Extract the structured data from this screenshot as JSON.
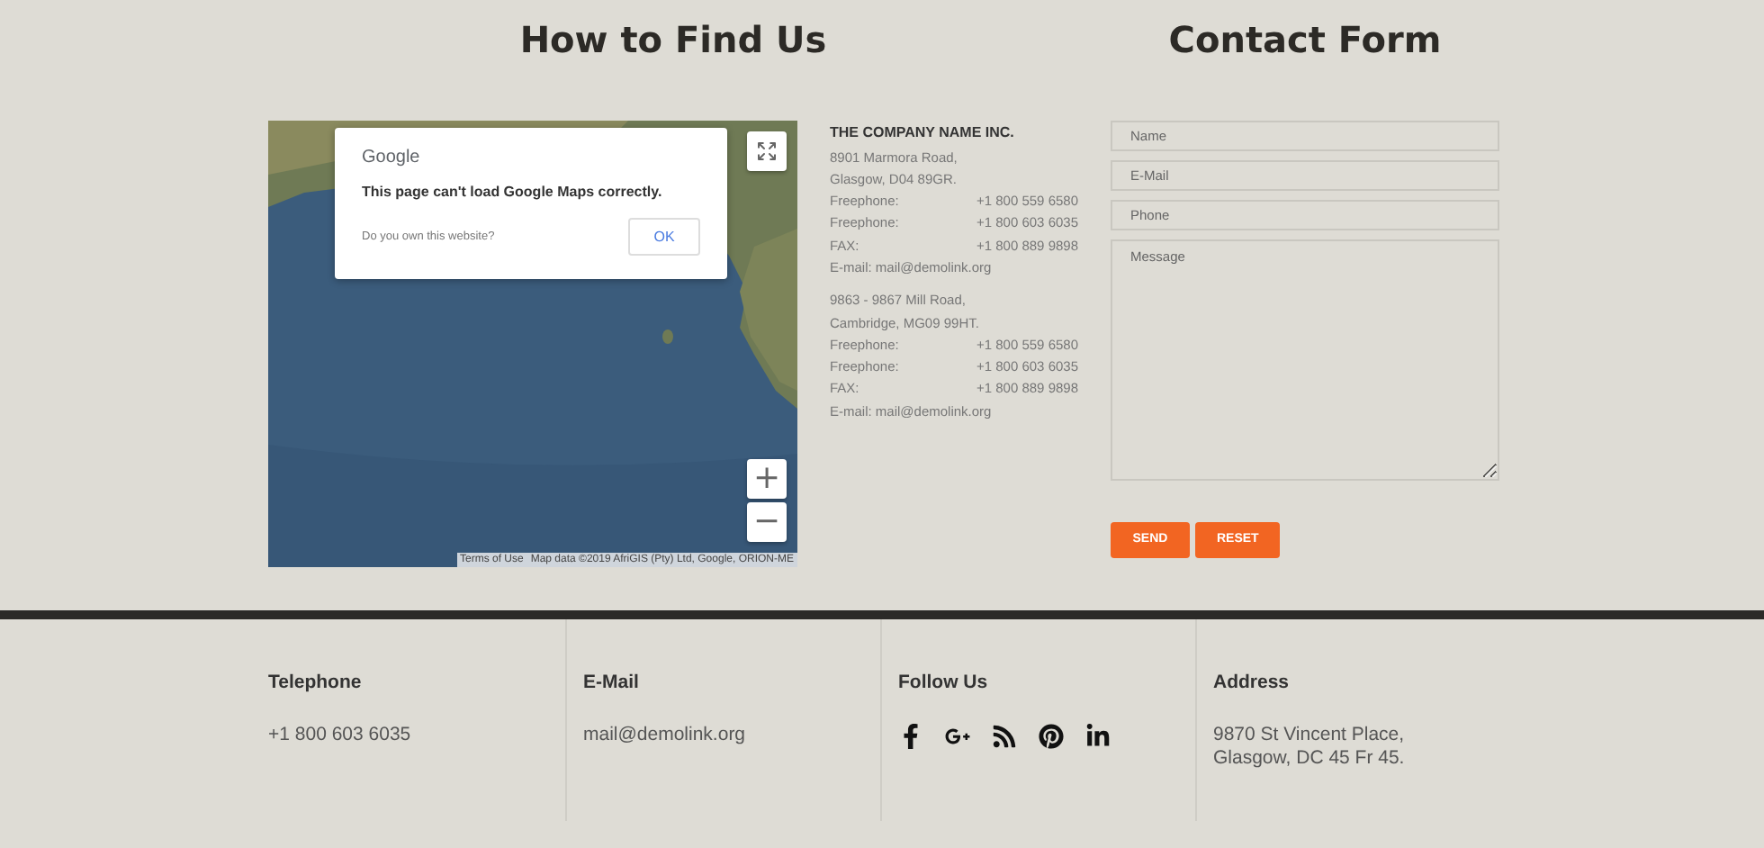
{
  "find_us": {
    "title": "How to Find Us",
    "map": {
      "kind": "picture",
      "dialog": {
        "brand": "Google",
        "message": "This page can't load Google Maps correctly.",
        "question": "Do you own this website?",
        "button": "OK"
      },
      "zoom_in": "+",
      "zoom_out": "−",
      "terms": "Terms of Use",
      "attribution": "Map data ©2019 AfriGIS (Pty) Ltd, Google, ORION-ME"
    },
    "company": "THE COMPANY NAME INC.",
    "offices": [
      {
        "address": [
          "8901 Marmora Road,",
          "Glasgow, D04 89GR."
        ],
        "phones": [
          {
            "label": "Freephone:",
            "value": "+1 800 559 6580"
          },
          {
            "label": "Freephone:",
            "value": "+1 800 603 6035"
          },
          {
            "label": "FAX:",
            "value": "+1 800 889 9898"
          }
        ],
        "email": "E-mail: mail@demolink.org"
      },
      {
        "address": [
          "9863 - 9867 Mill Road,",
          "Cambridge, MG09 99HT."
        ],
        "phones": [
          {
            "label": "Freephone:",
            "value": "+1 800 559 6580"
          },
          {
            "label": "Freephone:",
            "value": "+1 800 603 6035"
          },
          {
            "label": "FAX:",
            "value": "+1 800 889 9898"
          }
        ],
        "email": "E-mail: mail@demolink.org"
      }
    ]
  },
  "contact_form": {
    "title": "Contact Form",
    "fields": [
      {
        "kind": "input",
        "placeholder": "Name"
      },
      {
        "kind": "input",
        "placeholder": "E-Mail"
      },
      {
        "kind": "input",
        "placeholder": "Phone"
      },
      {
        "kind": "textarea",
        "placeholder": "Message"
      }
    ],
    "buttons": [
      "SEND",
      "RESET"
    ]
  },
  "footer": [
    {
      "kind": "text",
      "title": "Telephone",
      "lines": [
        "+1 800 603 6035"
      ]
    },
    {
      "kind": "text",
      "title": "E-Mail",
      "lines": [
        "mail@demolink.org"
      ]
    },
    {
      "kind": "social",
      "title": "Follow Us",
      "icons": [
        {
          "kind": "facebook"
        },
        {
          "kind": "google-plus"
        },
        {
          "kind": "rss"
        },
        {
          "kind": "pinterest"
        },
        {
          "kind": "linkedin"
        }
      ]
    },
    {
      "kind": "text",
      "title": "Address",
      "lines": [
        "9870 St Vincent Place,",
        "Glasgow, DC 45 Fr 45."
      ]
    }
  ]
}
